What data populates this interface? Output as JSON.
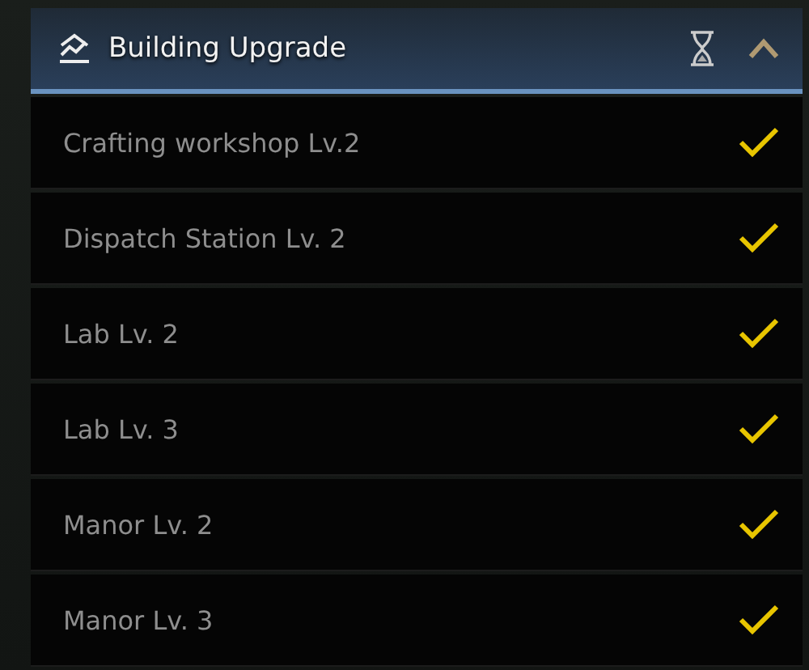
{
  "panel": {
    "title": "Building Upgrade",
    "expanded": true
  },
  "items": [
    {
      "label": "Crafting workshop Lv.2",
      "done": true
    },
    {
      "label": "Dispatch Station Lv. 2",
      "done": true
    },
    {
      "label": "Lab Lv. 2",
      "done": true
    },
    {
      "label": "Lab Lv. 3",
      "done": true
    },
    {
      "label": "Manor Lv. 2",
      "done": true
    },
    {
      "label": "Manor Lv. 3",
      "done": true
    }
  ]
}
